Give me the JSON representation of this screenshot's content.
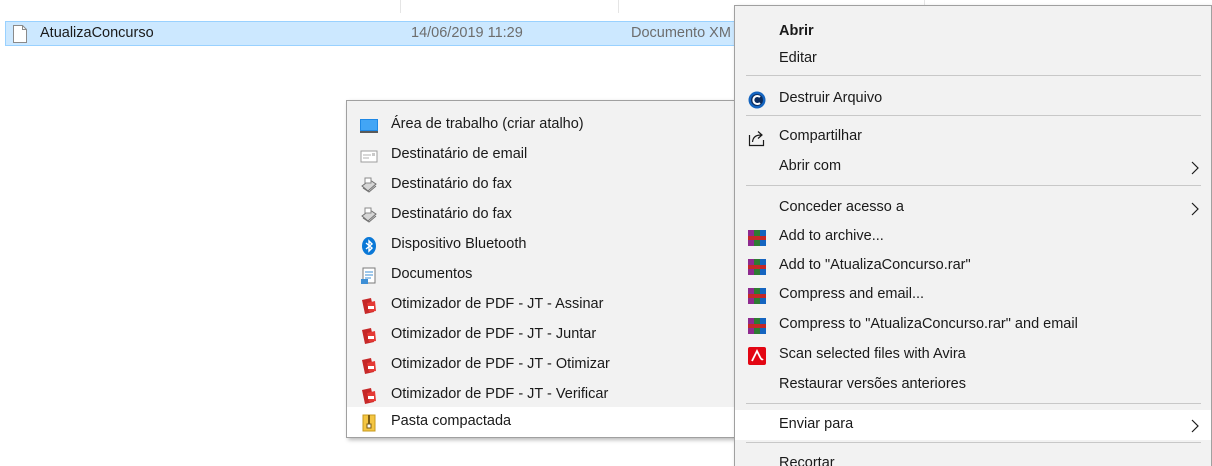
{
  "file_row": {
    "name": "AtualizaConcurso",
    "date_modified": "14/06/2019 11:29",
    "type": "Documento XM"
  },
  "context_menu": {
    "open": "Abrir",
    "edit": "Editar",
    "shred": "Destruir Arquivo",
    "share": "Compartilhar",
    "open_with": "Abrir com",
    "give_access": "Conceder acesso a",
    "add_archive": "Add to archive...",
    "add_rar": "Add to \"AtualizaConcurso.rar\"",
    "compress_email": "Compress and email...",
    "compress_rar_email": "Compress to \"AtualizaConcurso.rar\" and email",
    "avira_scan": "Scan selected files with Avira",
    "restore_versions": "Restaurar versões anteriores",
    "send_to": "Enviar para",
    "cut": "Recortar"
  },
  "send_to_menu": {
    "items": [
      {
        "label": "Área de trabalho (criar atalho)",
        "icon": "desktop-icon"
      },
      {
        "label": "Destinatário de email",
        "icon": "mail-icon"
      },
      {
        "label": "Destinatário do fax",
        "icon": "fax-icon"
      },
      {
        "label": "Destinatário do fax",
        "icon": "fax-icon"
      },
      {
        "label": "Dispositivo Bluetooth",
        "icon": "bluetooth-icon"
      },
      {
        "label": "Documentos",
        "icon": "documents-icon"
      },
      {
        "label": "Otimizador de PDF - JT - Assinar",
        "icon": "pdf-icon"
      },
      {
        "label": "Otimizador de PDF - JT - Juntar",
        "icon": "pdf-icon"
      },
      {
        "label": "Otimizador de PDF - JT - Otimizar",
        "icon": "pdf-icon"
      },
      {
        "label": "Otimizador de PDF - JT - Verificar",
        "icon": "pdf-icon"
      },
      {
        "label": "Pasta compactada",
        "icon": "zip-folder-icon"
      }
    ]
  },
  "colors": {
    "selection": "#cce8ff",
    "selection_border": "#99d1ff",
    "menu_bg": "#f2f2f2",
    "menu_highlight": "#ffffff",
    "avira_red": "#e30613",
    "bluetooth_blue": "#0a78d7"
  }
}
